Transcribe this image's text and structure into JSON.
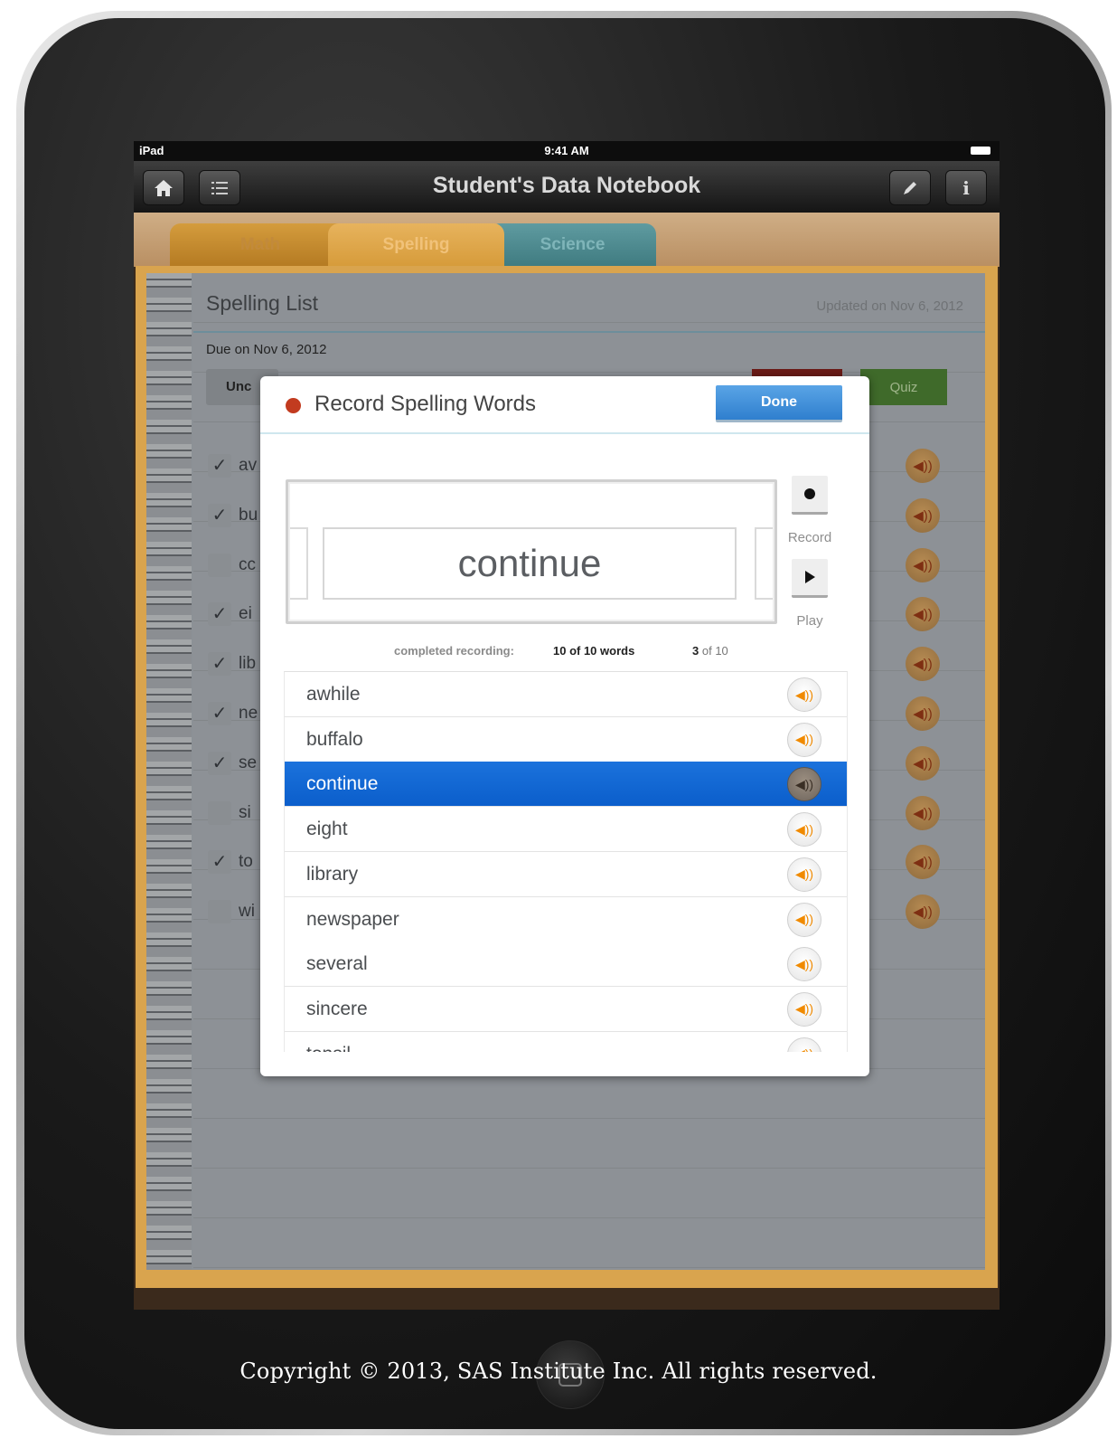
{
  "status_bar": {
    "carrier": "iPad",
    "time": "9:41 AM"
  },
  "nav_bar": {
    "title": "Student's Data Notebook",
    "home_icon": "home-icon",
    "list_icon": "list-icon",
    "edit_icon": "pencil-icon",
    "info_icon": "info-icon"
  },
  "tabs": [
    {
      "label": "Math"
    },
    {
      "label": "Spelling"
    },
    {
      "label": "Science"
    }
  ],
  "page": {
    "title": "Spelling List",
    "updated": "Updated on Nov 6, 2012",
    "due": "Due on Nov 6, 2012",
    "unc_button_label": "Unc",
    "quiz_button_label": "Quiz",
    "background_rows": [
      {
        "checked": true,
        "word": "av"
      },
      {
        "checked": true,
        "word": "bu"
      },
      {
        "checked": false,
        "word": "cc"
      },
      {
        "checked": true,
        "word": "ei"
      },
      {
        "checked": true,
        "word": "lib"
      },
      {
        "checked": true,
        "word": "ne"
      },
      {
        "checked": true,
        "word": "se"
      },
      {
        "checked": false,
        "word": "si"
      },
      {
        "checked": true,
        "word": "to"
      },
      {
        "checked": false,
        "word": "wi"
      }
    ]
  },
  "modal": {
    "title": "Record Spelling Words",
    "done_label": "Done",
    "current_word": "continue",
    "record_label": "Record",
    "play_label": "Play",
    "completed_label": "completed recording:",
    "completed_value": "10 of 10 words",
    "index_current": "3",
    "index_total": "of 10",
    "words": [
      "awhile",
      "buffalo",
      "continue",
      "eight",
      "library",
      "newspaper",
      "several",
      "sincere",
      "tonsil"
    ],
    "selected_index": 2
  },
  "footer": {
    "copyright": "Copyright © 2013, SAS Institute Inc. All rights reserved."
  },
  "colors": {
    "accent_blue": "#1b72dc",
    "record_red": "#c23b1f",
    "sound_orange": "#f08a00"
  }
}
